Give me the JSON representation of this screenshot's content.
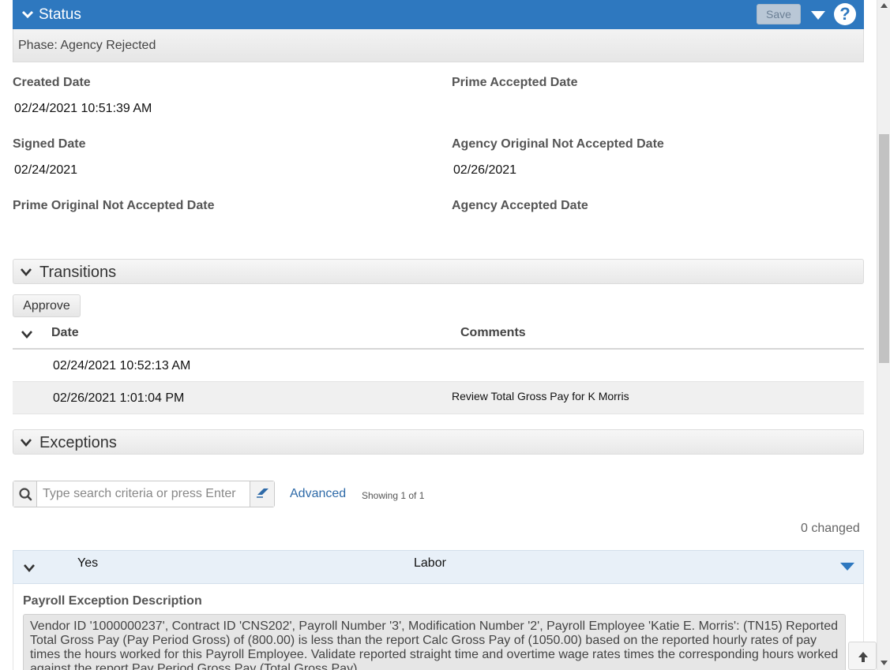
{
  "status": {
    "title": "Status",
    "save_label": "Save",
    "help_glyph": "?",
    "phase": "Phase: Agency Rejected"
  },
  "fields": {
    "created_date_label": "Created Date",
    "created_date_value": "02/24/2021 10:51:39 AM",
    "prime_accepted_label": "Prime Accepted Date",
    "prime_accepted_value": "",
    "signed_date_label": "Signed Date",
    "signed_date_value": "02/24/2021",
    "agency_orig_not_accepted_label": "Agency Original Not Accepted Date",
    "agency_orig_not_accepted_value": "02/26/2021",
    "prime_orig_not_accepted_label": "Prime Original Not Accepted Date",
    "prime_orig_not_accepted_value": "",
    "agency_accepted_label": "Agency Accepted Date",
    "agency_accepted_value": ""
  },
  "transitions": {
    "title": "Transitions",
    "approve_label": "Approve",
    "columns": [
      "Date",
      "Comments"
    ],
    "rows": [
      {
        "date": "02/24/2021 10:52:13 AM",
        "comment": ""
      },
      {
        "date": "02/26/2021 1:01:04 PM",
        "comment": "Review Total Gross Pay for K Morris"
      }
    ]
  },
  "exceptions": {
    "title": "Exceptions",
    "search_placeholder": "Type search criteria or press Enter",
    "advanced_label": "Advanced",
    "showing": "Showing 1 of 1",
    "changed": "0 changed",
    "row": {
      "flag": "Yes",
      "type": "Labor"
    },
    "description_label": "Payroll Exception Description",
    "description": "Vendor ID '1000000237', Contract ID 'CNS202', Payroll Number '3', Modification Number '2', Payroll Employee 'Katie E. Morris': (TN15) Reported Total Gross Pay (Pay Period Gross) of (800.00) is less than the report  Calc Gross Pay of (1050.00) based on the reported hourly rates of pay times the hours worked for this Payroll Employee.  Validate reported straight time and overtime wage rates times the corresponding hours worked against the report Pay Period Gross  Pay (Total Gross Pay)."
  },
  "colors": {
    "accent": "#2e78bf",
    "link": "#2e6aa8"
  },
  "icons": [
    "chevron-down-icon",
    "caret-down-icon",
    "help-icon",
    "search-icon",
    "eraser-icon",
    "arrow-up-icon"
  ]
}
